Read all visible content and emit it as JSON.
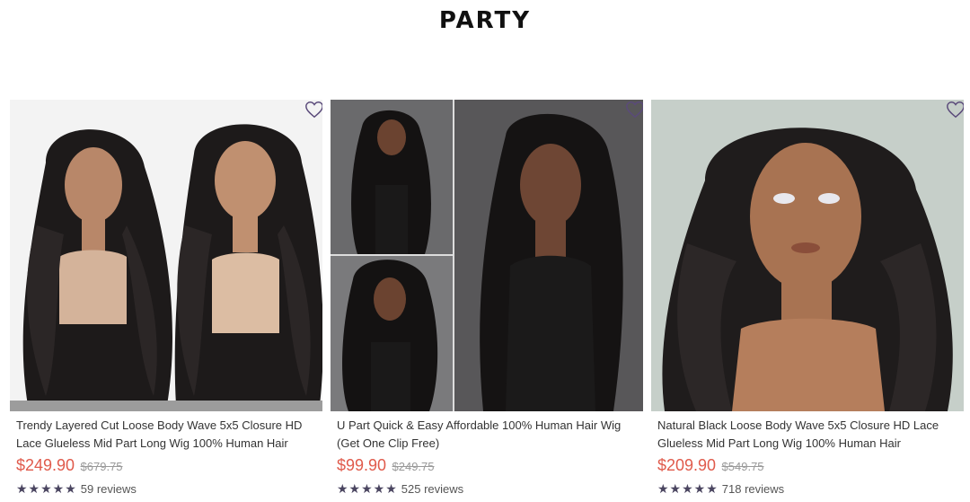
{
  "section": {
    "title": "PARTY"
  },
  "colors": {
    "price": "#e05a4b",
    "star": "#4a4560",
    "wishlist": "#5a4a7a"
  },
  "products": [
    {
      "title": "Trendy Layered Cut Loose Body Wave 5x5 Closure HD Lace Glueless Mid Part Long Wig 100% Human Hair",
      "price": "$249.90",
      "compare_price": "$679.75",
      "stars": "★★★★★",
      "rating": 5,
      "reviews": "59 reviews",
      "wishlist_icon": "heart-outline-icon",
      "image": "product-photo-two-mannequins-wavy-wig"
    },
    {
      "title": "U Part Quick & Easy Affordable 100% Human Hair Wig (Get One Clip Free)",
      "price": "$99.90",
      "compare_price": "$249.75",
      "stars": "★★★★★",
      "rating": 5,
      "reviews": "525 reviews",
      "wishlist_icon": "heart-outline-icon",
      "image": "product-photo-model-collage"
    },
    {
      "title": "Natural Black Loose Body Wave 5x5 Closure HD Lace Glueless Mid Part Long Wig 100% Human Hair",
      "price": "$209.90",
      "compare_price": "$549.75",
      "stars": "★★★★★",
      "rating": 5,
      "reviews": "718 reviews",
      "wishlist_icon": "heart-outline-icon",
      "image": "product-photo-mannequin-closeup"
    }
  ]
}
